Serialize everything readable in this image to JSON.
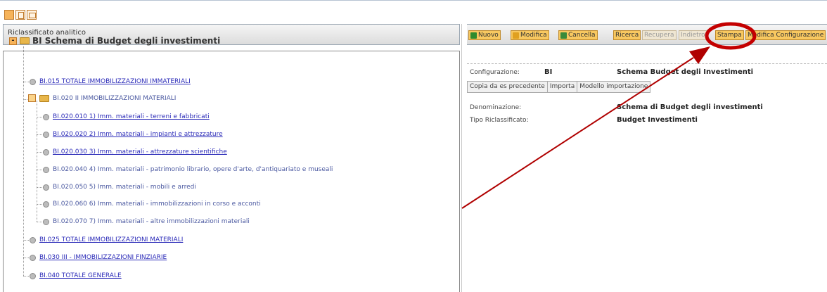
{
  "left_panel": {
    "header_title": "Riclassificato analitico",
    "root_label": "BI Schema di Budget degli investimenti",
    "nodes": [
      {
        "label": "BI.015 TOTALE IMMOBILIZZAZIONI IMMATERIALI"
      },
      {
        "label": "BI.020 II   IMMOBILIZZAZIONI MATERIALI"
      },
      {
        "label": "BI.020.010 1) Imm. materiali - terreni e fabbricati"
      },
      {
        "label": "BI.020.020 2) Imm. materiali - impianti e attrezzature"
      },
      {
        "label": "BI.020.030 3) Imm. materiali - attrezzature scientifiche"
      },
      {
        "label": "BI.020.040 4) Imm. materiali - patrimonio librario, opere d'arte, d'antiquariato e museali"
      },
      {
        "label": "BI.020.050 5) Imm. materiali - mobili e arredi"
      },
      {
        "label": "BI.020.060 6) Imm. materiali - immobilizzazioni in corso e acconti"
      },
      {
        "label": "BI.020.070 7) Imm. materiali - altre immobilizzazioni materiali"
      },
      {
        "label": "BI.025 TOTALE IMMOBILIZZAZIONI MATERIALI"
      },
      {
        "label": "BI.030 III - IMMOBILIZZAZIONI FINZIARIE"
      },
      {
        "label": "BI.040 TOTALE GENERALE"
      }
    ]
  },
  "toolbar": {
    "nuovo": "Nuovo",
    "modifica": "Modifica",
    "cancella": "Cancella",
    "ricerca": "Ricerca",
    "recupera": "Recupera",
    "indietro": "Indietro",
    "stampa": "Stampa",
    "modifica_configurazione": "Modifica Configurazione"
  },
  "details": {
    "configurazione_label": "Configurazione:",
    "configurazione_code": "BI",
    "configurazione_value": "Schema Budget degli Investimenti",
    "denominazione_label": "Denominazione:",
    "denominazione_value": "Schema di Budget degli investimenti",
    "tipo_label": "Tipo Riclassificato:",
    "tipo_value": "Budget Investimenti"
  },
  "tabs": [
    "Copia da es precedente",
    "Importa",
    "Modello importazione"
  ],
  "colors": {
    "button_fill": "#f8c860",
    "highlight_circle": "#c40000",
    "arrow": "#b00000",
    "link": "#2b2bb8"
  }
}
